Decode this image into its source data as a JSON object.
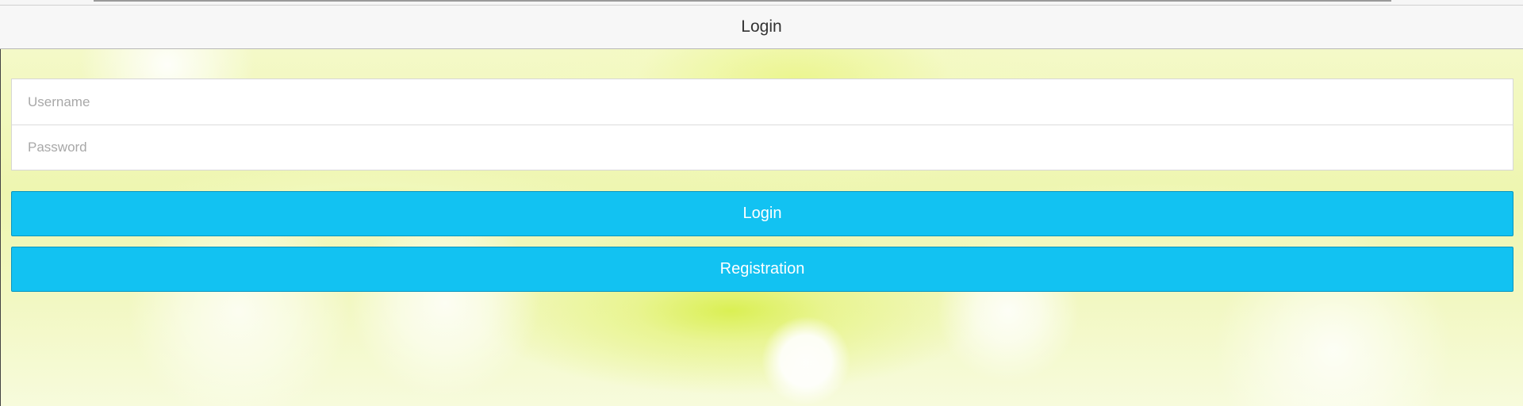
{
  "header": {
    "title": "Login"
  },
  "form": {
    "username_placeholder": "Username",
    "password_placeholder": "Password"
  },
  "buttons": {
    "login_label": "Login",
    "register_label": "Registration"
  },
  "colors": {
    "button": "#12c2f2",
    "header_bg": "#f7f7f7"
  }
}
